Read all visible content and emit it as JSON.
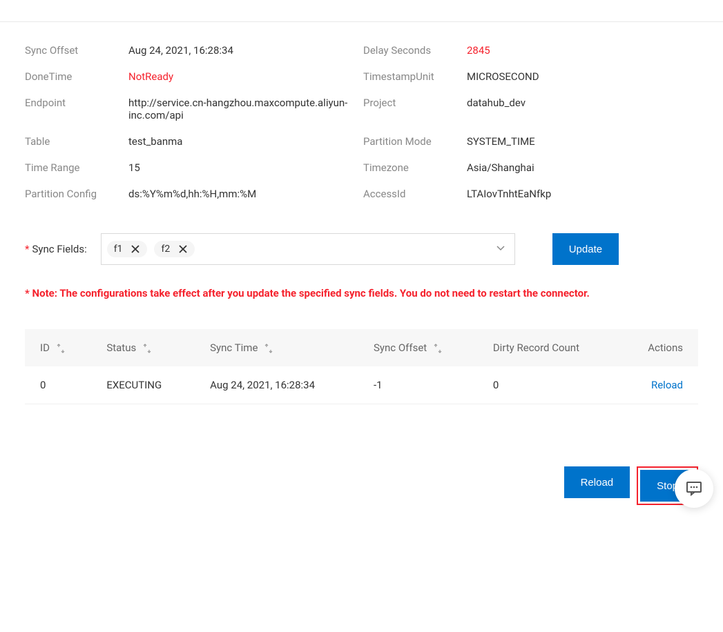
{
  "info": {
    "sync_offset_label": "Sync Offset",
    "sync_offset_value": "Aug 24, 2021, 16:28:34",
    "delay_seconds_label": "Delay Seconds",
    "delay_seconds_value": "2845",
    "done_time_label": "DoneTime",
    "done_time_value": "NotReady",
    "timestamp_unit_label": "TimestampUnit",
    "timestamp_unit_value": "MICROSECOND",
    "endpoint_label": "Endpoint",
    "endpoint_value": "http://service.cn-hangzhou.maxcompute.aliyun-inc.com/api",
    "project_label": "Project",
    "project_value": "datahub_dev",
    "table_label": "Table",
    "table_value": "test_banma",
    "partition_mode_label": "Partition Mode",
    "partition_mode_value": "SYSTEM_TIME",
    "time_range_label": "Time Range",
    "time_range_value": "15",
    "timezone_label": "Timezone",
    "timezone_value": "Asia/Shanghai",
    "partition_config_label": "Partition Config",
    "partition_config_value": "ds:%Y%m%d,hh:%H,mm:%M",
    "access_id_label": "AccessId",
    "access_id_value": "LTAIovTnhtEaNfkp"
  },
  "sync_fields": {
    "label": "Sync Fields:",
    "tags": [
      "f1",
      "f2"
    ],
    "update_label": "Update"
  },
  "note_text": "* Note: The configurations take effect after you update the specified sync fields. You do not need to restart the connector.",
  "table": {
    "headers": {
      "id": "ID",
      "status": "Status",
      "sync_time": "Sync Time",
      "sync_offset": "Sync Offset",
      "dirty_count": "Dirty Record Count",
      "actions": "Actions"
    },
    "rows": [
      {
        "id": "0",
        "status": "EXECUTING",
        "sync_time": "Aug 24, 2021, 16:28:34",
        "sync_offset": "-1",
        "dirty_count": "0",
        "action_label": "Reload"
      }
    ]
  },
  "footer": {
    "reload": "Reload",
    "stop": "Stop"
  }
}
